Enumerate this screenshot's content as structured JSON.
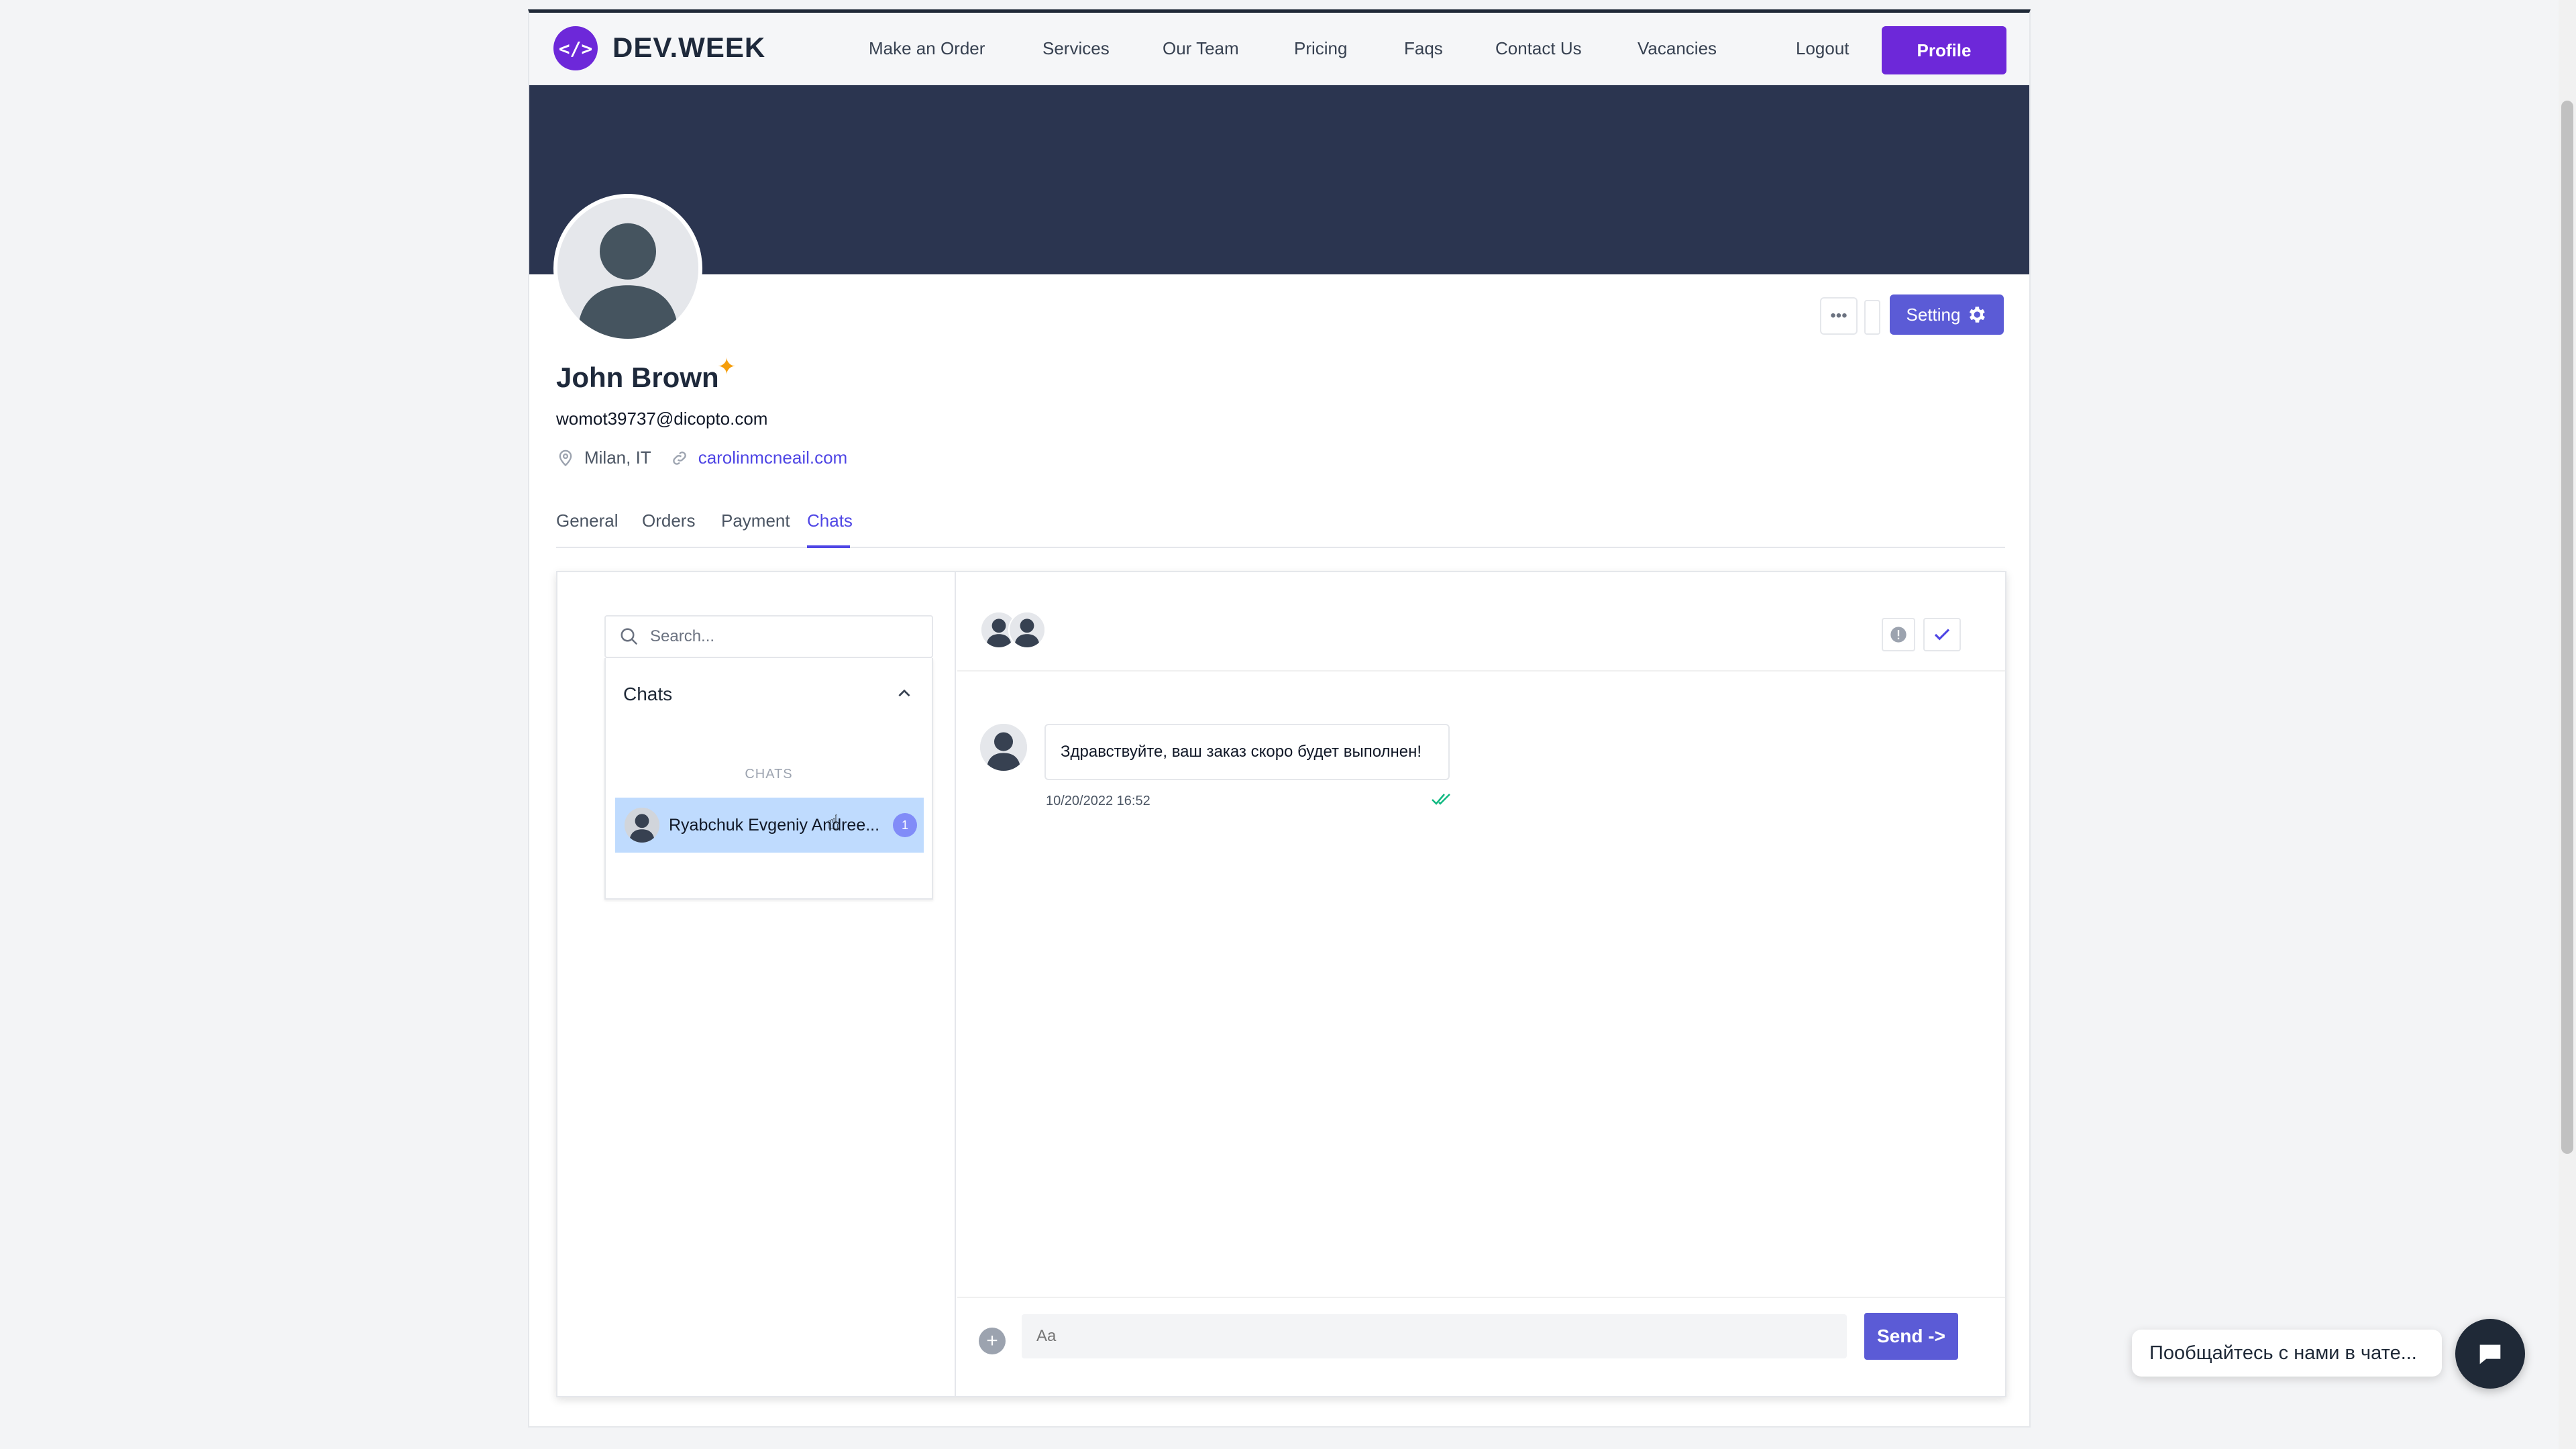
{
  "nav": {
    "logo_glyph": "</>",
    "brand": "DEV.WEEK",
    "links": [
      "Make an Order",
      "Services",
      "Our Team",
      "Pricing",
      "Faqs",
      "Contact Us",
      "Vacancies",
      "Logout"
    ],
    "profile_label": "Profile"
  },
  "profile": {
    "name": "John Brown",
    "email": "womot39737@dicopto.com",
    "location": "Milan, IT",
    "website": "carolinmcneail.com",
    "more_label": "•••",
    "setting_label": "Setting"
  },
  "tabs": {
    "items": [
      "General",
      "Orders",
      "Payment",
      "Chats"
    ],
    "active": "Chats"
  },
  "chats": {
    "search_placeholder": "Search...",
    "list_title": "Chats",
    "section_label": "CHATS",
    "items": [
      {
        "name": "Ryabchuk Evgeniy Andree...",
        "unread": "1"
      }
    ],
    "message": {
      "text": "Здравствуйте, ваш заказ скоро будет выполнен!",
      "time": "10/20/2022 16:52"
    },
    "composer_placeholder": "Aa",
    "send_label": "Send ->"
  },
  "widget": {
    "prompt": "Пообщайтесь с нами в чате..."
  },
  "colors": {
    "brand": "#6d28d9",
    "accent": "#5b5bd6",
    "cover": "#2b3550",
    "selected_chat": "#bfdbfe"
  }
}
